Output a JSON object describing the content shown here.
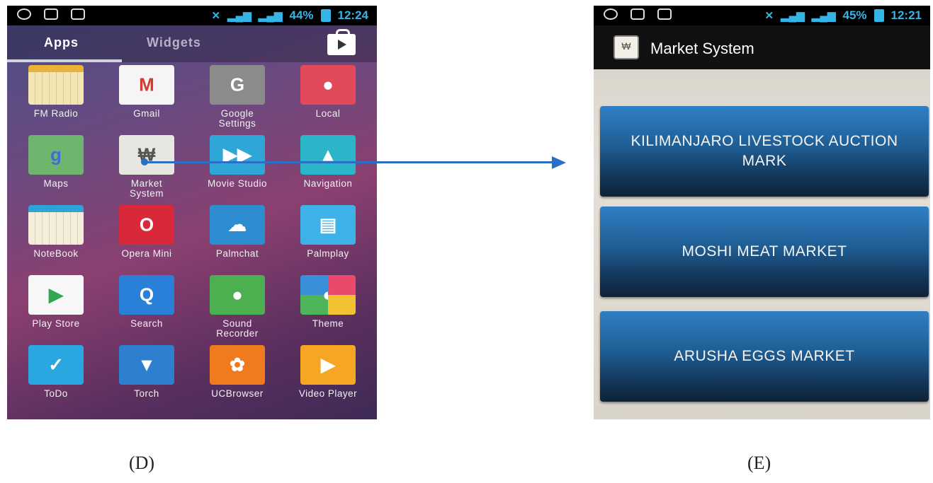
{
  "left_phone": {
    "status": {
      "battery": "44%",
      "time": "12:24"
    },
    "tabs": {
      "apps": "Apps",
      "widgets": "Widgets"
    },
    "apps": [
      {
        "label": "FM Radio",
        "icon": "fm-radio-icon",
        "color": "#f4e6b4"
      },
      {
        "label": "Gmail",
        "icon": "gmail-icon",
        "color": "#f5f5f5"
      },
      {
        "label": "Google Settings",
        "icon": "google-settings-icon",
        "color": "#8b8b8b"
      },
      {
        "label": "Local",
        "icon": "local-icon",
        "color": "#e24a5c"
      },
      {
        "label": "Maps",
        "icon": "maps-icon",
        "color": "#6fb56e"
      },
      {
        "label": "Market System",
        "icon": "market-system-icon",
        "color": "#e8e6e0"
      },
      {
        "label": "Movie Studio",
        "icon": "movie-studio-icon",
        "color": "#2fa6d8"
      },
      {
        "label": "Navigation",
        "icon": "navigation-icon",
        "color": "#2bb5c9"
      },
      {
        "label": "NoteBook",
        "icon": "notebook-icon",
        "color": "#f3edd9"
      },
      {
        "label": "Opera Mini",
        "icon": "opera-mini-icon",
        "color": "#d8283a"
      },
      {
        "label": "Palmchat",
        "icon": "palmchat-icon",
        "color": "#2d8dd0"
      },
      {
        "label": "Palmplay",
        "icon": "palmplay-icon",
        "color": "#3eb1e8"
      },
      {
        "label": "Play Store",
        "icon": "play-store-icon",
        "color": "#f7f7f7"
      },
      {
        "label": "Search",
        "icon": "search-icon",
        "color": "#2a7fd8"
      },
      {
        "label": "Sound Recorder",
        "icon": "sound-recorder-icon",
        "color": "#4caf50"
      },
      {
        "label": "Theme",
        "icon": "theme-icon",
        "color": "#f0a030"
      },
      {
        "label": "ToDo",
        "icon": "todo-icon",
        "color": "#2aa6e0"
      },
      {
        "label": "Torch",
        "icon": "torch-icon",
        "color": "#2f7fd0"
      },
      {
        "label": "UCBrowser",
        "icon": "ucbrowser-icon",
        "color": "#f07a1e"
      },
      {
        "label": "Video Player",
        "icon": "video-player-icon",
        "color": "#f5a623"
      }
    ]
  },
  "right_phone": {
    "status": {
      "battery": "45%",
      "time": "12:21"
    },
    "title": "Market System",
    "markets": [
      "KILIMANJARO LIVESTOCK AUCTION MARK",
      "MOSHI MEAT MARKET",
      "ARUSHA EGGS MARKET"
    ]
  },
  "captions": {
    "left": "(D)",
    "right": "(E)"
  },
  "colors": {
    "arrow": "#2a6fc4",
    "status_accent": "#35b5e5",
    "button_top": "#2f7fc4",
    "button_bottom": "#0d2238"
  }
}
